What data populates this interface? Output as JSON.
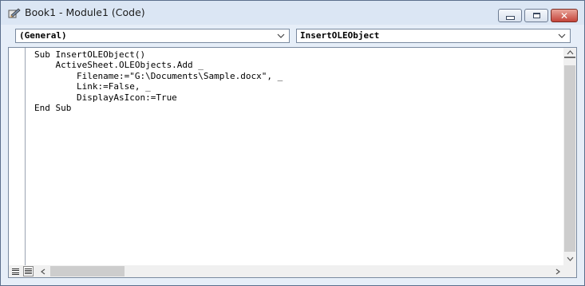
{
  "window": {
    "title": "Book1 - Module1 (Code)",
    "icons": {
      "app": "vba-module-icon",
      "minimize": "minimize-icon",
      "maximize": "maximize-icon",
      "close": "close-icon"
    },
    "colors": {
      "title_bg": "#dbe6f4",
      "close_button": "#c4443a"
    }
  },
  "object_dropdown": {
    "value": "(General)"
  },
  "procedure_dropdown": {
    "value": "InsertOLEObject"
  },
  "code": {
    "lines": [
      "Sub InsertOLEObject()",
      "    ActiveSheet.OLEObjects.Add _",
      "        Filename:=\"G:\\Documents\\Sample.docx\", _",
      "        Link:=False, _",
      "        DisplayAsIcon:=True",
      "End Sub"
    ]
  },
  "scrollbars": {
    "vertical_thumb_icon": "scroll-thumb",
    "horizontal_thumb_icon": "scroll-thumb"
  }
}
